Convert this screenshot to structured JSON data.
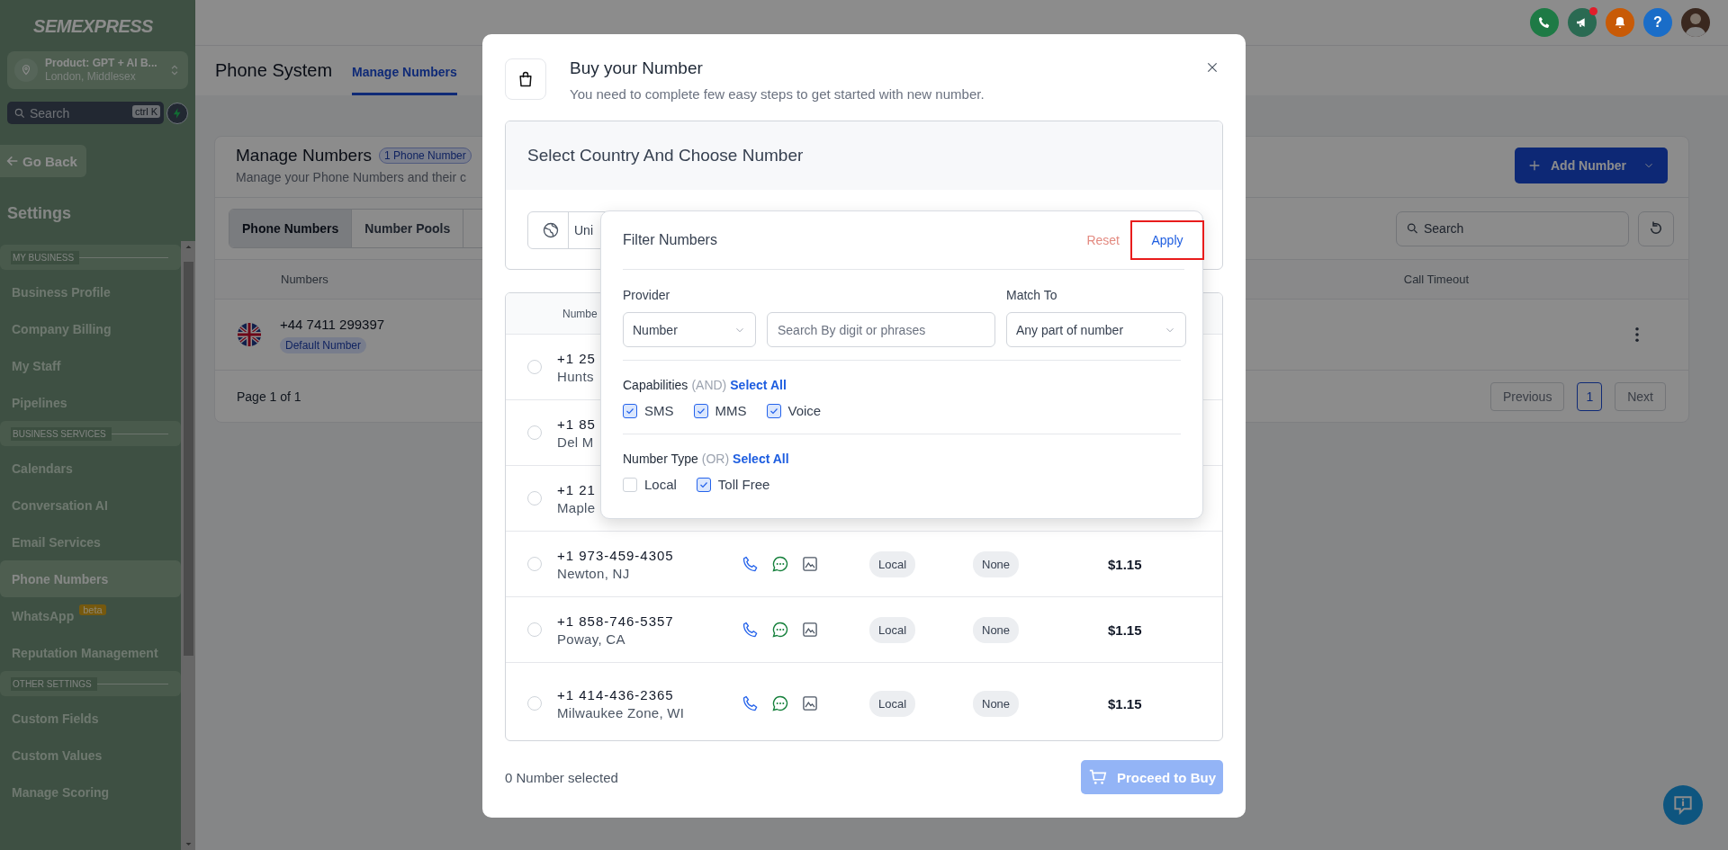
{
  "sidebar": {
    "logo": "SEMEXPRESS",
    "location": {
      "name": "Product: GPT + AI B...",
      "address": "London, Middlesex"
    },
    "search": {
      "placeholder": "Search",
      "shortcut": "ctrl K"
    },
    "back": "Go Back",
    "heading": "Settings",
    "sections": [
      {
        "title": "MY BUSINESS",
        "items": [
          {
            "label": "Business Profile",
            "selected": false
          },
          {
            "label": "Company Billing",
            "selected": false
          },
          {
            "label": "My Staff",
            "selected": false
          },
          {
            "label": "Pipelines",
            "selected": false
          }
        ]
      },
      {
        "title": "BUSINESS SERVICES",
        "items": [
          {
            "label": "Calendars",
            "selected": false
          },
          {
            "label": "Conversation AI",
            "selected": false
          },
          {
            "label": "Email Services",
            "selected": false
          },
          {
            "label": "Phone Numbers",
            "selected": true
          },
          {
            "label": "WhatsApp",
            "badge": "beta",
            "selected": false
          },
          {
            "label": "Reputation Management",
            "selected": false
          }
        ]
      },
      {
        "title": "OTHER SETTINGS",
        "items": [
          {
            "label": "Custom Fields",
            "selected": false
          },
          {
            "label": "Custom Values",
            "selected": false
          },
          {
            "label": "Manage Scoring",
            "selected": false
          }
        ]
      }
    ]
  },
  "header": {
    "actions": [
      {
        "kind": "phone",
        "color": "#1e7a45"
      },
      {
        "kind": "megaphone",
        "color": "#2a6a52",
        "dot": true
      },
      {
        "kind": "bell",
        "color": "#c85a06"
      },
      {
        "kind": "help",
        "color": "#1a6dc8",
        "label": "?"
      },
      {
        "kind": "avatar"
      }
    ]
  },
  "page": {
    "title": "Phone System",
    "tabs": [
      {
        "label": "Manage Numbers",
        "selected": true
      }
    ],
    "card": {
      "title": "Manage Numbers",
      "badge": "1 Phone Number",
      "subtitle": "Manage your Phone Numbers and their c",
      "add_button": "Add Number",
      "views": [
        {
          "label": "Phone Numbers",
          "selected": true
        },
        {
          "label": "Number Pools",
          "selected": false
        }
      ],
      "search": {
        "placeholder": "Search"
      },
      "columns": [
        "Numbers",
        "Call Timeout"
      ],
      "rows": [
        {
          "number": "+44 7411 299397",
          "badge": "Default Number"
        }
      ],
      "pagination": {
        "summary": "Page 1 of 1",
        "previous": "Previous",
        "pages": [
          {
            "label": "1",
            "selected": true
          }
        ],
        "next": "Next"
      }
    }
  },
  "modal": {
    "title": "Buy your Number",
    "subtitle": "You need to complete few easy steps to get started with new number.",
    "section_title": "Select Country And Choose Number",
    "country": "Uni",
    "table": {
      "column": "Numbe",
      "rows": [
        {
          "number": "+1 25",
          "location": "Hunts",
          "selected": false
        },
        {
          "number": "+1 85",
          "location": "Del M",
          "selected": false
        },
        {
          "number": "+1 21",
          "location": "Maple",
          "selected": false
        },
        {
          "number": "+1 973-459-4305",
          "location": "Newton, NJ",
          "selected": false,
          "capabilities": [
            {
              "kind": "voice"
            },
            {
              "kind": "sms"
            },
            {
              "kind": "mms"
            }
          ],
          "type": "Local",
          "tag": "None",
          "price": "$1.15"
        },
        {
          "number": "+1 858-746-5357",
          "location": "Poway, CA",
          "selected": false,
          "capabilities": [
            {
              "kind": "voice"
            },
            {
              "kind": "sms"
            },
            {
              "kind": "mms"
            }
          ],
          "type": "Local",
          "tag": "None",
          "price": "$1.15"
        },
        {
          "number": "+1 414-436-2365",
          "location": "Milwaukee Zone, WI",
          "selected": false,
          "capabilities": [
            {
              "kind": "voice"
            },
            {
              "kind": "sms"
            },
            {
              "kind": "mms"
            }
          ],
          "type": "Local",
          "tag": "None",
          "price": "$1.15"
        }
      ]
    },
    "footer": {
      "summary": "0 Number selected",
      "button": "Proceed to Buy",
      "button_disabled": true
    },
    "filter": {
      "title": "Filter Numbers",
      "reset": "Reset",
      "apply": "Apply",
      "apply_outlined": true,
      "provider_label": "Provider",
      "provider": "Number",
      "search_placeholder": "Search By digit or phrases",
      "match_label": "Match To",
      "match": "Any part of number",
      "groups": [
        {
          "label": "Capabilities",
          "qualifier": "(AND)",
          "select_all": "Select All",
          "options": [
            {
              "label": "SMS",
              "checked": true
            },
            {
              "label": "MMS",
              "checked": true
            },
            {
              "label": "Voice",
              "checked": true
            }
          ]
        },
        {
          "label": "Number Type",
          "qualifier": "(OR)",
          "select_all": "Select All",
          "options": [
            {
              "label": "Local",
              "checked": false
            },
            {
              "label": "Toll Free",
              "checked": true
            }
          ]
        }
      ]
    }
  }
}
